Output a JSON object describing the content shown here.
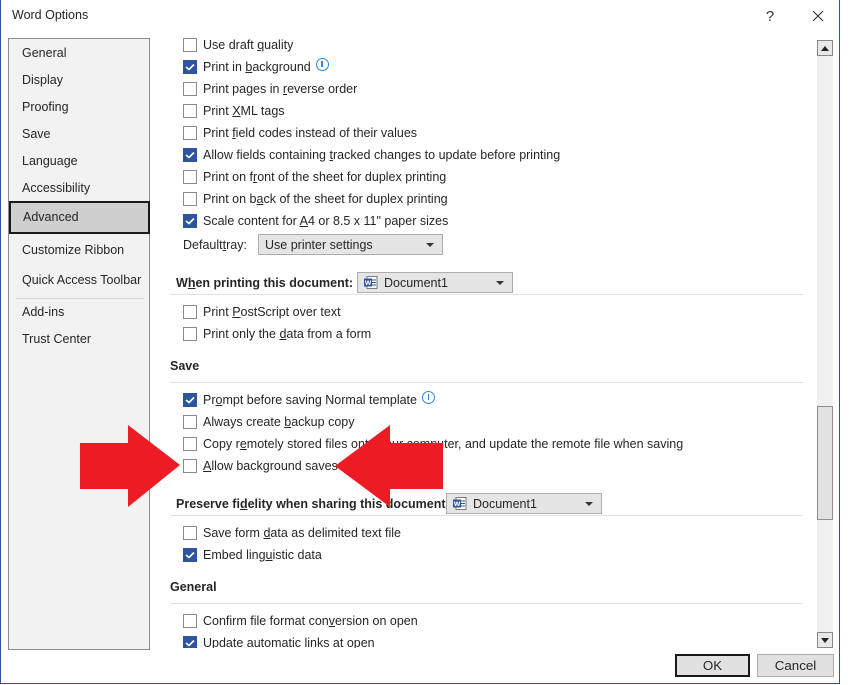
{
  "window": {
    "title": "Word Options",
    "help_label": "?",
    "close_label": "✕"
  },
  "sidebar": {
    "items": [
      {
        "label": "General",
        "selected": false
      },
      {
        "label": "Display",
        "selected": false
      },
      {
        "label": "Proofing",
        "selected": false
      },
      {
        "label": "Save",
        "selected": false
      },
      {
        "label": "Language",
        "selected": false
      },
      {
        "label": "Accessibility",
        "selected": false
      },
      {
        "label": "Advanced",
        "selected": true
      },
      {
        "label": "Customize Ribbon",
        "selected": false
      },
      {
        "label": "Quick Access Toolbar",
        "selected": false
      },
      {
        "label": "Add-ins",
        "selected": false
      },
      {
        "label": "Trust Center",
        "selected": false
      }
    ]
  },
  "print": {
    "options": [
      {
        "pre": "Use draft ",
        "key": "q",
        "post": "uality",
        "checked": false
      },
      {
        "pre": "Print in ",
        "key": "b",
        "post": "ackground",
        "checked": true,
        "info": true
      },
      {
        "pre": "Print pages in ",
        "key": "r",
        "post": "everse order",
        "checked": false
      },
      {
        "pre": "Print ",
        "key": "X",
        "post": "ML tags",
        "checked": false
      },
      {
        "pre": "Print ",
        "key": "f",
        "post": "ield codes instead of their values",
        "checked": false
      },
      {
        "pre": "Allow fields containing ",
        "key": "t",
        "post": "racked changes to update before printing",
        "checked": true
      },
      {
        "pre": "Print on f",
        "key": "r",
        "post": "ont of the sheet for duplex printing",
        "checked": false
      },
      {
        "pre": "Print on b",
        "key": "a",
        "post": "ck of the sheet for duplex printing",
        "checked": false
      },
      {
        "pre": "Scale content for ",
        "key": "A",
        "post": "4 or 8.5 x 11\" paper sizes",
        "checked": true
      }
    ],
    "default_tray_label_pre": "Default ",
    "default_tray_label_key": "t",
    "default_tray_label_post": "ray:",
    "default_tray_value": "Use printer settings"
  },
  "when_printing": {
    "label_pre": "W",
    "label_key": "h",
    "label_post": "en printing this document:",
    "document": "Document1",
    "options": [
      {
        "pre": "Print ",
        "key": "P",
        "post": "ostScript over text",
        "checked": false
      },
      {
        "pre": "Print only the ",
        "key": "d",
        "post": "ata from a form",
        "checked": false
      }
    ]
  },
  "save": {
    "heading": "Save",
    "options": [
      {
        "pre": "Pr",
        "key": "o",
        "post": "mpt before saving Normal template",
        "checked": true,
        "info": true
      },
      {
        "pre": "Always create ",
        "key": "b",
        "post": "ackup copy",
        "checked": false
      },
      {
        "pre": "Copy r",
        "key": "e",
        "post": "motely stored files onto your computer, and update the remote file when saving",
        "checked": false
      },
      {
        "pre": "",
        "key": "A",
        "post": "llow background saves",
        "checked": false
      }
    ]
  },
  "preserve_fidelity": {
    "label_pre": "Preserve fi",
    "label_key": "d",
    "label_post": "elity when sharing this document:",
    "document": "Document1",
    "options": [
      {
        "pre": "Save form ",
        "key": "d",
        "post": "ata as delimited text file",
        "checked": false
      },
      {
        "pre": "Embed ling",
        "key": "u",
        "post": "istic data",
        "checked": true
      }
    ]
  },
  "general": {
    "heading": "General",
    "options": [
      {
        "pre": "Confirm file format con",
        "key": "v",
        "post": "ersion on open",
        "checked": false
      },
      {
        "pre": "Update automatic links at open",
        "key": "",
        "post": "",
        "checked": true
      }
    ]
  },
  "footer": {
    "ok_label": "OK",
    "cancel_label": "Cancel"
  },
  "annotations": {
    "arrow_color": "#ed1c24",
    "target": "Allow background saves"
  },
  "colors": {
    "accent": "#2b579a",
    "info": "#2b88d8"
  }
}
